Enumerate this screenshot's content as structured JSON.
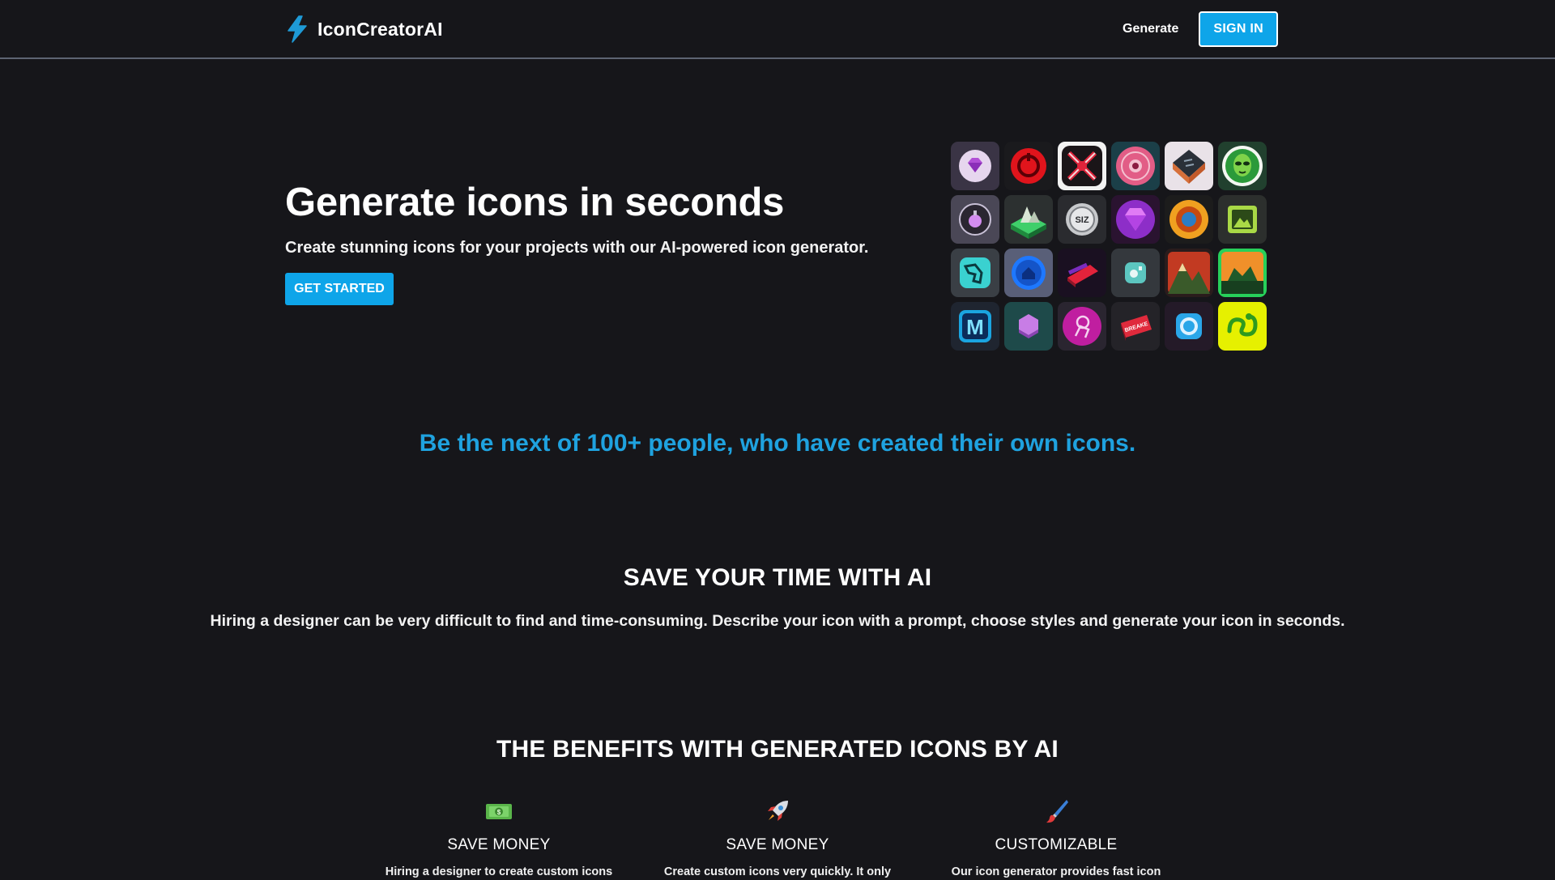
{
  "nav": {
    "brand": "IconCreatorAI",
    "generate_link": "Generate",
    "sign_in": "SIGN IN"
  },
  "hero": {
    "title": "Generate icons in seconds",
    "subtitle": "Create stunning icons for your projects with our AI-powered icon generator.",
    "cta": "GET STARTED"
  },
  "gallery": {
    "icons": [
      "gem-icon",
      "power-ring-icon",
      "crossed-blades-icon",
      "pink-badge-icon",
      "dark-cube-icon",
      "alien-head-icon",
      "potion-orb-icon",
      "green-island-icon",
      "coin-siz-icon",
      "purple-gem-icon",
      "gold-medal-icon",
      "landscape-frame-icon",
      "teal-arm-icon",
      "blue-home-icon",
      "red-tilted-card-icon",
      "teal-camera-icon",
      "mountain-sunset-icon",
      "volcano-icon",
      "letter-m-icon",
      "violet-hexagon-icon",
      "magenta-astronaut-icon",
      "red-ticket-icon",
      "blue-lens-icon",
      "green-snake-icon"
    ]
  },
  "tagline": "Be the next of 100+ people, who have created their own icons.",
  "time_section": {
    "title": "SAVE YOUR TIME WITH AI",
    "text": "Hiring a designer can be very difficult to find and time-consuming. Describe your icon with a prompt, choose styles and generate your icon in seconds."
  },
  "benefits": {
    "title": "THE BENEFITS WITH GENERATED ICONS BY AI",
    "items": [
      {
        "icon": "money-icon",
        "title": "SAVE MONEY",
        "text": "Hiring a designer to create custom icons"
      },
      {
        "icon": "rocket-icon",
        "title": "SAVE MONEY",
        "text": "Create custom icons very quickly. It only"
      },
      {
        "icon": "paintbrush-icon",
        "title": "CUSTOMIZABLE",
        "text": "Our icon generator provides fast icon"
      }
    ]
  },
  "colors": {
    "background": "#16161a",
    "accent": "#0ea5e9",
    "tagline": "#1fa2df",
    "nav_border": "#5d6472"
  }
}
